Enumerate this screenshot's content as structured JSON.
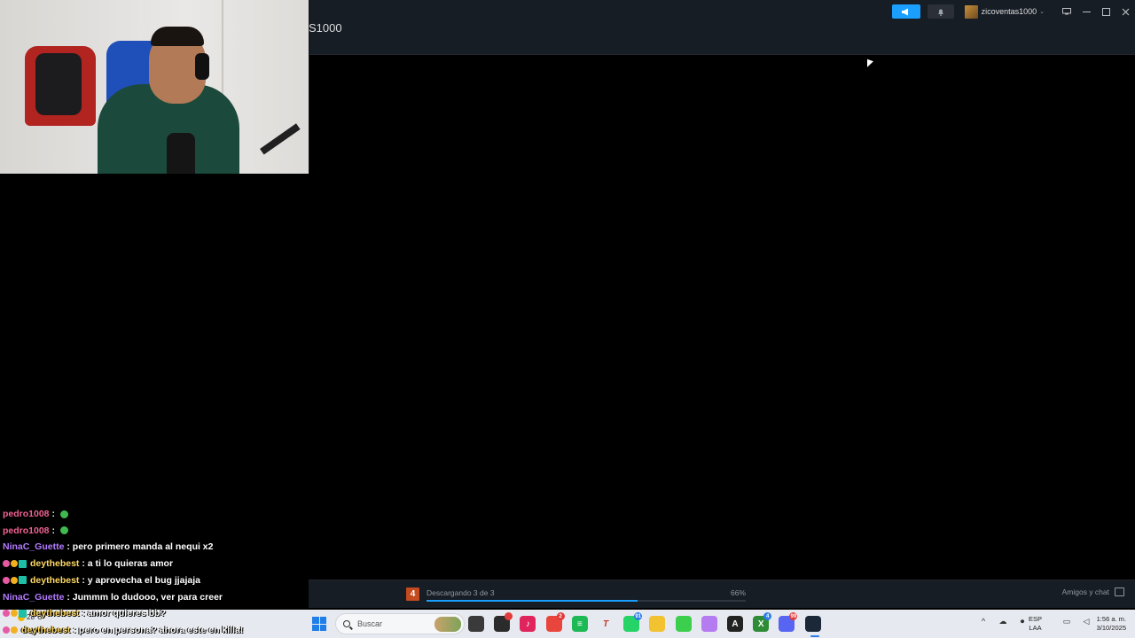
{
  "steam": {
    "page_title": "S1000",
    "account_name": "zicoventas1000",
    "icons": {
      "announce": "megaphone-icon",
      "notifications": "bell-icon",
      "big_picture": "monitor-icon",
      "minimize": "minimize-icon",
      "maximize": "maximize-icon",
      "close": "close-icon"
    },
    "accent_color": "#1a9fff",
    "bottom_bar": {
      "download_badge": "4",
      "download_status": "Descargando 3 de 3",
      "download_percent_label": "66%",
      "download_progress": 0.66,
      "friends_label": "Amigos y chat"
    }
  },
  "chat": {
    "messages": [
      {
        "user": "pedro1008",
        "color": "#f06292",
        "text": "",
        "badges": []
      },
      {
        "user": "pedro1008",
        "color": "#f06292",
        "text": "",
        "badges": []
      },
      {
        "user": "NinaC_Guette",
        "color": "#b47cff",
        "text": "pero primero manda al nequi x2",
        "badges": []
      },
      {
        "user": "deythebest",
        "color": "#ffd966",
        "text": "a ti lo quieras amor",
        "badges": [
          "pink",
          "gold",
          "teal"
        ]
      },
      {
        "user": "deythebest",
        "color": "#ffd966",
        "text": "y aprovecha el bug jjajaja",
        "badges": [
          "pink",
          "gold",
          "teal"
        ]
      },
      {
        "user": "NinaC_Guette",
        "color": "#b47cff",
        "text": "Jummm lo dudooo, ver para creer",
        "badges": []
      },
      {
        "user": "deythebest",
        "color": "#ffd966",
        "text": "amor quieres bb?",
        "badges": [
          "pink",
          "gold",
          "teal"
        ]
      },
      {
        "user": "deythebest",
        "color": "#ffd966",
        "text": "pero en persona? ahora este en killa!",
        "badges": [
          "pink",
          "gold"
        ]
      }
    ]
  },
  "taskbar": {
    "weather_temp": "28°C",
    "search_placeholder": "Buscar",
    "apps": [
      {
        "name": "file-icon",
        "color": "#3a3a3a",
        "glyph": ""
      },
      {
        "name": "obs-icon",
        "color": "#2b2b2b",
        "glyph": "",
        "badge": ""
      },
      {
        "name": "tiktok-icon",
        "color": "#e0245e",
        "glyph": "♪"
      },
      {
        "name": "chrome-icon",
        "color": "#e8453c",
        "glyph": "",
        "badge": "2"
      },
      {
        "name": "spotify-icon",
        "color": "#1db954",
        "glyph": "≡"
      },
      {
        "name": "text-icon",
        "color": "#e6e9ef",
        "glyph": "T"
      },
      {
        "name": "whatsapp-icon",
        "color": "#25d366",
        "glyph": "",
        "badge": "91"
      },
      {
        "name": "folder-icon",
        "color": "#f2c230",
        "glyph": ""
      },
      {
        "name": "line-icon",
        "color": "#3ccf4e",
        "glyph": ""
      },
      {
        "name": "controller-icon",
        "color": "#b57cf2",
        "glyph": ""
      },
      {
        "name": "epic-icon",
        "color": "#222",
        "glyph": "A"
      },
      {
        "name": "xbox-icon",
        "color": "#2e8b36",
        "glyph": "X",
        "badge": "4"
      },
      {
        "name": "discord-icon",
        "color": "#5865f2",
        "glyph": "",
        "badge": "99"
      },
      {
        "name": "steam-icon",
        "color": "#1b2838",
        "glyph": ""
      }
    ],
    "language": [
      "ESP",
      "LAA"
    ],
    "time": "1:56 a. m.",
    "date": "3/10/2025"
  }
}
